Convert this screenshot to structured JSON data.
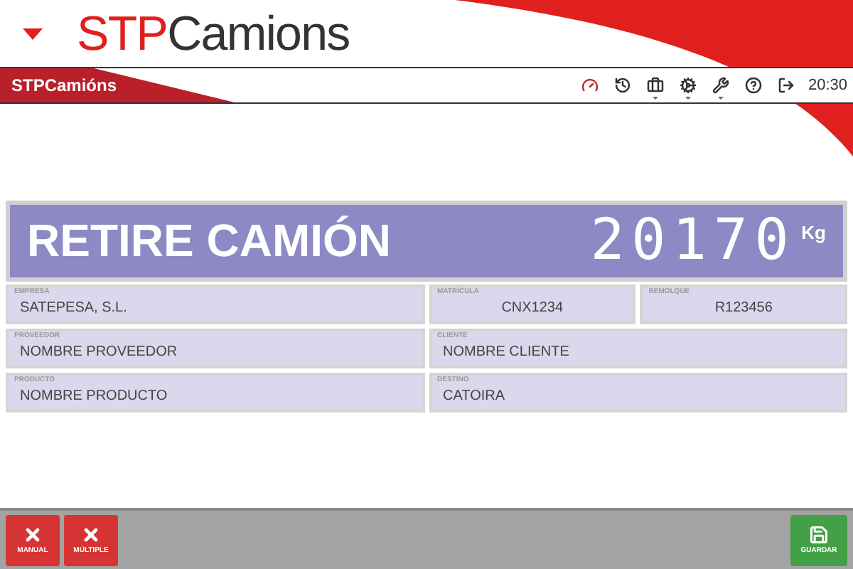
{
  "logo": {
    "prefix": "STP",
    "name": "Camions"
  },
  "navbar": {
    "title": "STPCamións",
    "time": "20:30"
  },
  "message": "RETIRE CAMIÓN",
  "weight": {
    "value": "20170",
    "unit": "Kg"
  },
  "fields": [
    {
      "label": "EMPRESA",
      "value": "SATEPESA, S.L."
    },
    {
      "label": "MATRÍCULA",
      "value": "CNX1234"
    },
    {
      "label": "REMOLQUE",
      "value": "R123456"
    },
    {
      "label": "PROVEEDOR",
      "value": "NOMBRE PROVEEDOR"
    },
    {
      "label": "CLIENTE",
      "value": "NOMBRE CLIENTE"
    },
    {
      "label": "PRODUCTO",
      "value": "NOMBRE PRODUCTO"
    },
    {
      "label": "DESTINO",
      "value": "CATOIRA"
    }
  ],
  "buttons": [
    {
      "label": "MANUAL",
      "kind": "cancel"
    },
    {
      "label": "MÚLTIPLE",
      "kind": "cancel"
    },
    {
      "label": "GUARDAR",
      "kind": "save"
    }
  ]
}
